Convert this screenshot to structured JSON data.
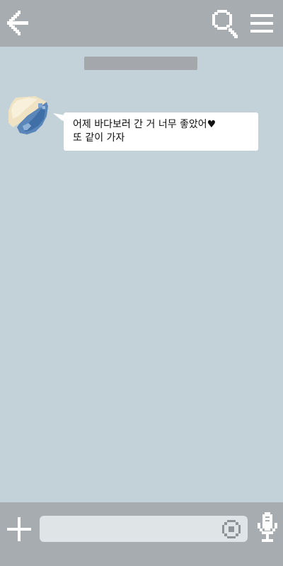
{
  "colors": {
    "header_background": "#a7acb1",
    "chat_background": "#c3d2d8",
    "bubble_background": "#ffffff",
    "footer_background": "#a7acb1",
    "input_background": "#dfe4e6",
    "icon_color": "#ffffff"
  },
  "header": {
    "icons": [
      "back-arrow-icon",
      "search-icon",
      "menu-icon"
    ]
  },
  "chat": {
    "date_divider": "",
    "messages": [
      {
        "sender_avatar": "pixel-avatar-icon",
        "lines": [
          "어제 바다보러 간 거 너무 좋았어♥",
          "또 같이 가자"
        ]
      }
    ]
  },
  "footer": {
    "input": {
      "value": "",
      "placeholder": ""
    },
    "icons": [
      "plus-icon",
      "emoji-icon",
      "microphone-icon"
    ]
  }
}
